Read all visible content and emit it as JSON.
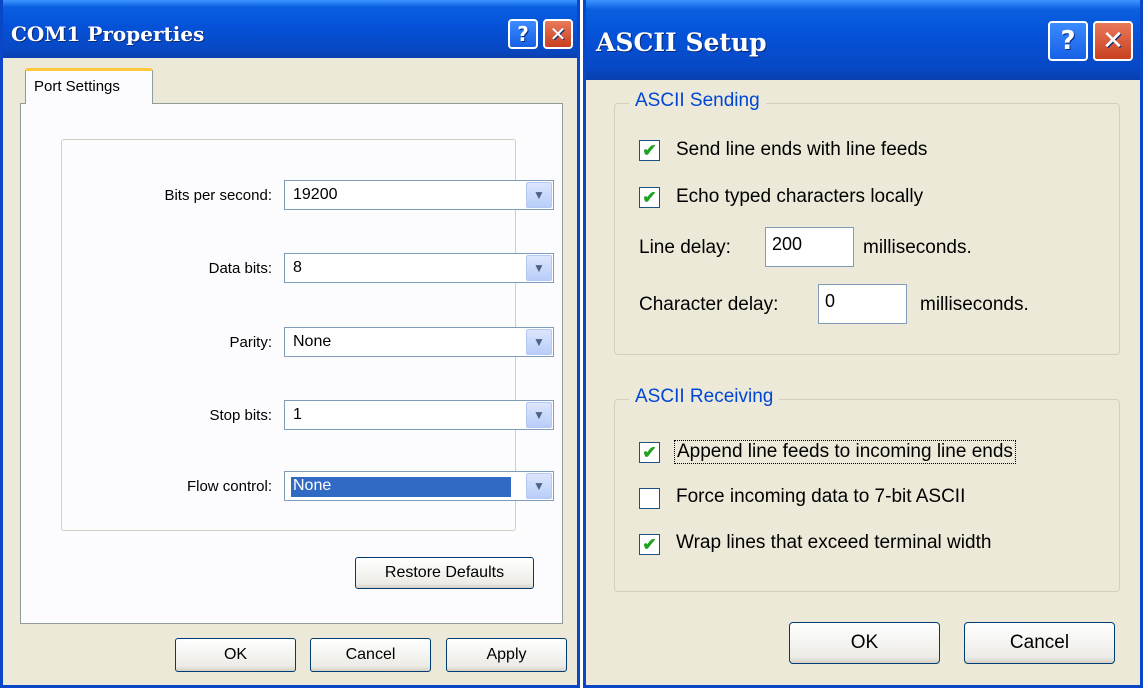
{
  "dialog1": {
    "title": "COM1 Properties",
    "help_glyph": "?",
    "close_glyph": "✕",
    "tab_label": "Port Settings",
    "fields": [
      {
        "label": "Bits per second:",
        "value": "19200"
      },
      {
        "label": "Data bits:",
        "value": "8"
      },
      {
        "label": "Parity:",
        "value": "None"
      },
      {
        "label": "Stop bits:",
        "value": "1"
      },
      {
        "label": "Flow control:",
        "value": "None"
      }
    ],
    "dropdown_glyph": "▼",
    "restore_label": "Restore Defaults",
    "ok_label": "OK",
    "cancel_label": "Cancel",
    "apply_label": "Apply"
  },
  "dialog2": {
    "title": "ASCII Setup",
    "help_glyph": "?",
    "close_glyph": "✕",
    "sending": {
      "legend": "ASCII Sending",
      "send_line_ends": {
        "label": "Send line ends with line feeds",
        "checked": true
      },
      "echo_typed": {
        "label": "Echo typed characters locally",
        "checked": true
      },
      "line_delay_label": "Line delay:",
      "line_delay_value": "200",
      "line_delay_unit": "milliseconds.",
      "char_delay_label": "Character delay:",
      "char_delay_value": "0",
      "char_delay_unit": "milliseconds."
    },
    "receiving": {
      "legend": "ASCII Receiving",
      "append_line_feeds": {
        "label": "Append line feeds to incoming line ends",
        "checked": true
      },
      "force_7bit": {
        "label": "Force incoming data to 7-bit ASCII",
        "checked": false
      },
      "wrap_lines": {
        "label": "Wrap lines that exceed terminal width",
        "checked": true
      }
    },
    "check_glyph": "✔",
    "ok_label": "OK",
    "cancel_label": "Cancel"
  },
  "colors": {
    "titlebar_blue": "#0552d8",
    "dialog_face": "#ece9d8",
    "groupbox_title": "#0046d5",
    "checkmark_green": "#21a121",
    "selection_blue": "#316ac5"
  }
}
